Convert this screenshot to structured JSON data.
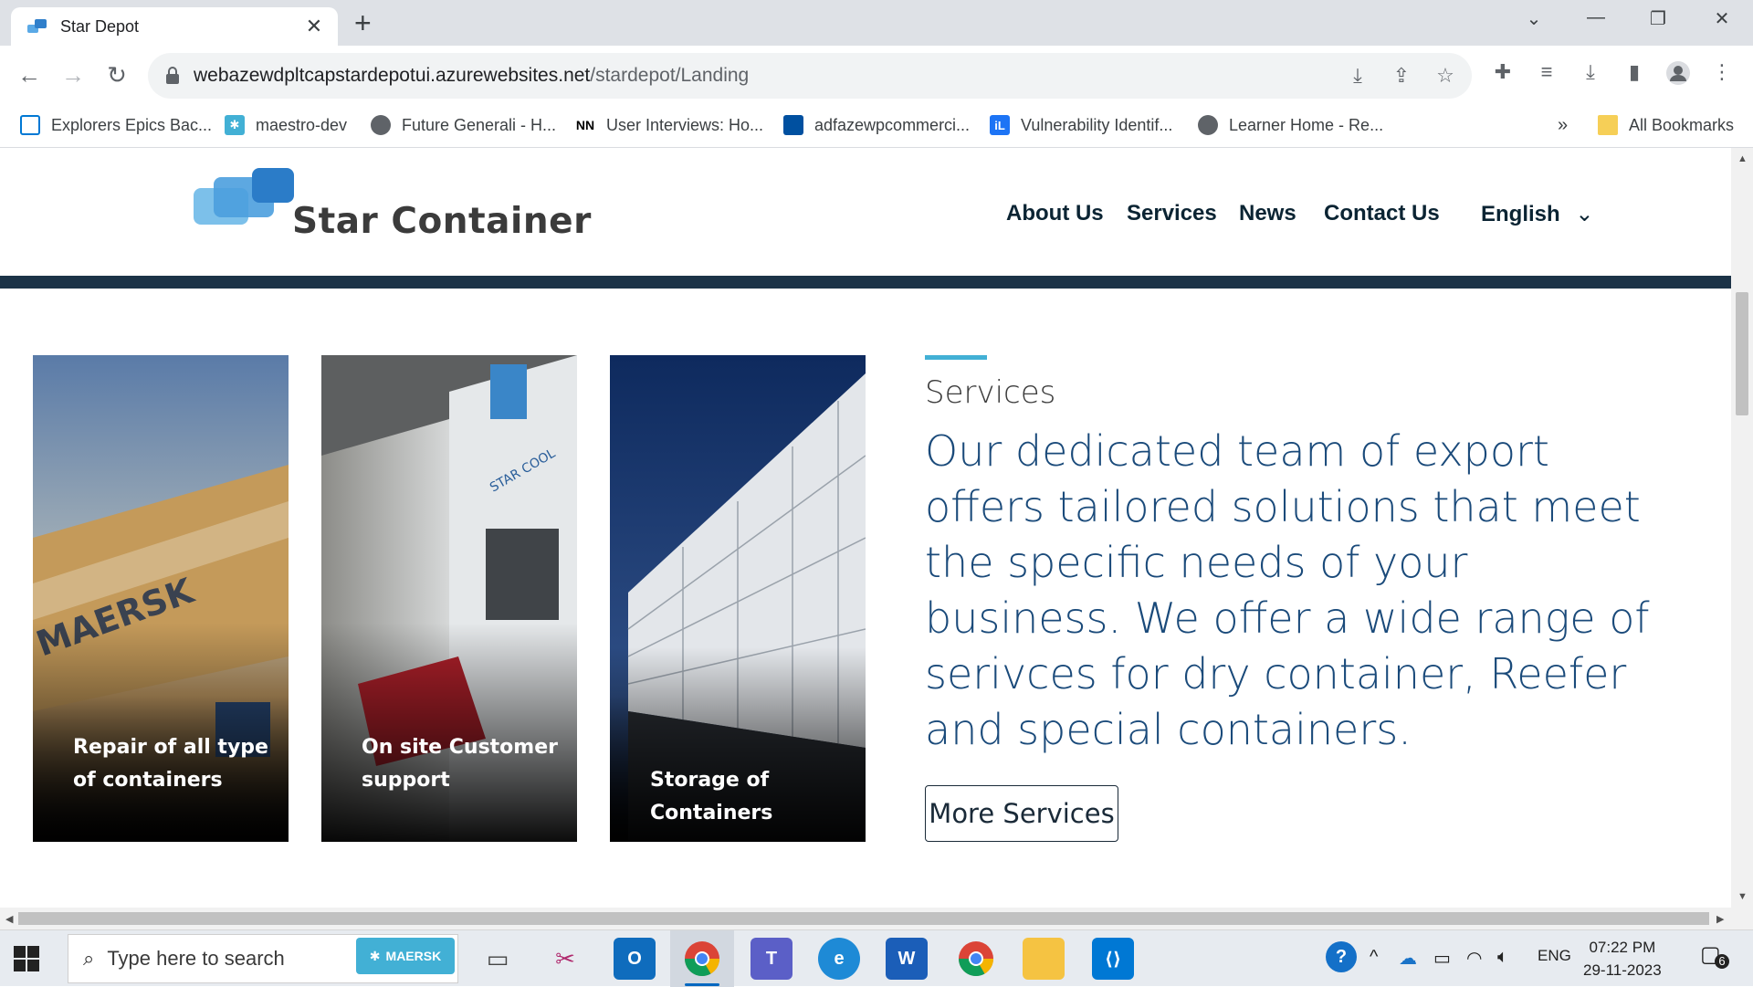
{
  "browser": {
    "tab_title": "Star Depot",
    "url_host": "webazewdpltcapstardepotui.azurewebsites.net",
    "url_path": "/stardepot/Landing",
    "bookmarks": [
      "Explorers Epics Bac...",
      "maestro-dev",
      "Future Generali - H...",
      "User Interviews: Ho...",
      "adfazewpcommerci...",
      "Vulnerability Identif...",
      "Learner Home - Re..."
    ],
    "bookmarks_overflow": "»",
    "all_bookmarks": "All Bookmarks"
  },
  "site": {
    "brand": "Star Container",
    "nav": [
      "About Us",
      "Services",
      "News",
      "Contact Us"
    ],
    "language": "English"
  },
  "cards": [
    "Repair of all type of containers",
    "On site Customer support",
    "Storage of Containers"
  ],
  "services": {
    "title": "Services",
    "body": "Our dedicated team of export offers tailored solutions that meet the specific needs of your business. We offer a wide range of serivces for dry container, Reefer and special containers.",
    "more_button": "More Services"
  },
  "taskbar": {
    "search_placeholder": "Type here to search",
    "maersk_chip": "MAERSK",
    "language": "ENG",
    "time": "07:22 PM",
    "date": "29-11-2023",
    "notification_count": "6"
  },
  "colors": {
    "accent": "#42b0d5",
    "heading_blue": "#1a4a7a",
    "hero_strip": "#1c3347"
  }
}
